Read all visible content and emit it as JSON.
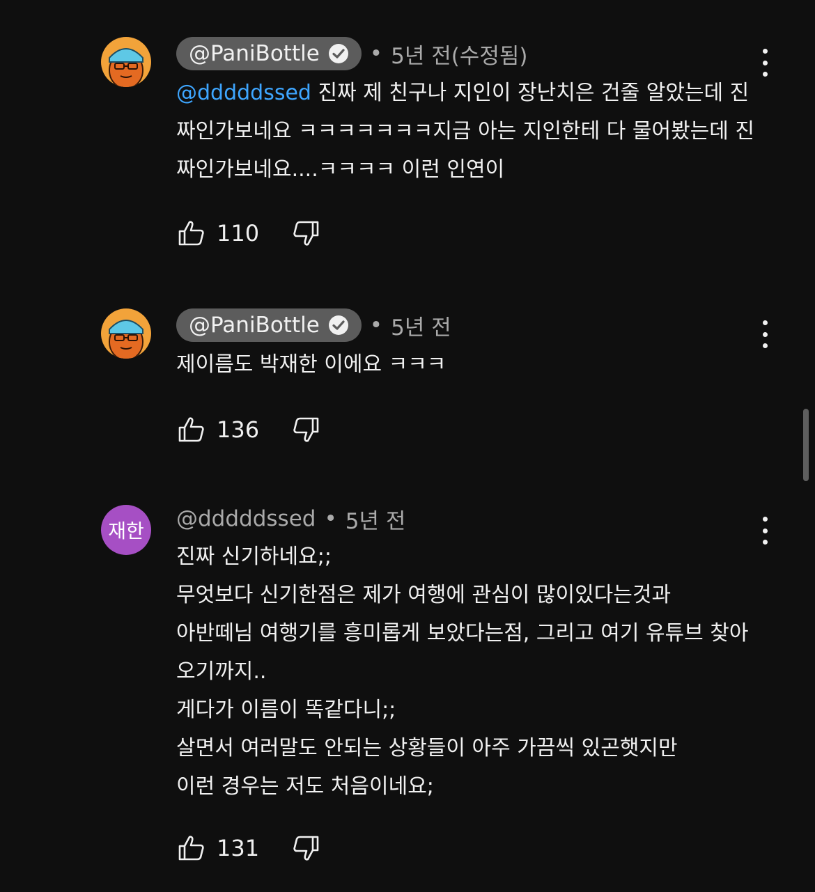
{
  "comments": [
    {
      "author": "@PaniBottle",
      "verified": true,
      "time": "5년 전(수정됨)",
      "mention": "@dddddssed",
      "text": " 진짜 제 친구나 지인이 장난치은 건줄 알았는데 진짜인가보네요 ㅋㅋㅋㅋㅋㅋㅋ지금 아는 지인한테 다 물어봤는데 진짜인가보네요....ㅋㅋㅋㅋ 이런 인연이",
      "likes": "110",
      "avatar_icon": "creator-avatar-icon"
    },
    {
      "author": "@PaniBottle",
      "verified": true,
      "time": "5년 전",
      "text": "제이름도 박재한 이에요 ㅋㅋㅋ",
      "likes": "136",
      "avatar_icon": "creator-avatar-icon"
    },
    {
      "author": "@dddddssed",
      "verified": false,
      "time": "5년 전",
      "avatar_initials": "재한",
      "avatar_color": "#a64fc4",
      "text": "진짜 신기하네요;;\n무엇보다 신기한점은 제가 여행에 관심이 많이있다는것과\n아반떼님 여행기를 흥미롭게 보았다는점, 그리고 여기 유튜브 찾아오기까지..\n게다가 이름이 똑같다니;;\n살면서 여러말도 안되는 상황들이 아주 가끔씩 있곤햇지만\n이런 경우는 저도 처음이네요;",
      "likes": "131"
    }
  ],
  "separator": "•",
  "icons": {
    "like": "thumb-up-icon",
    "dislike": "thumb-down-icon",
    "more": "more-vertical-icon",
    "verified": "verified-check-icon"
  },
  "colors": {
    "background": "#0f0f0f",
    "mention": "#3ea6ff",
    "pill": "#5c5c5c",
    "secondary_text": "#aaaaaa"
  }
}
